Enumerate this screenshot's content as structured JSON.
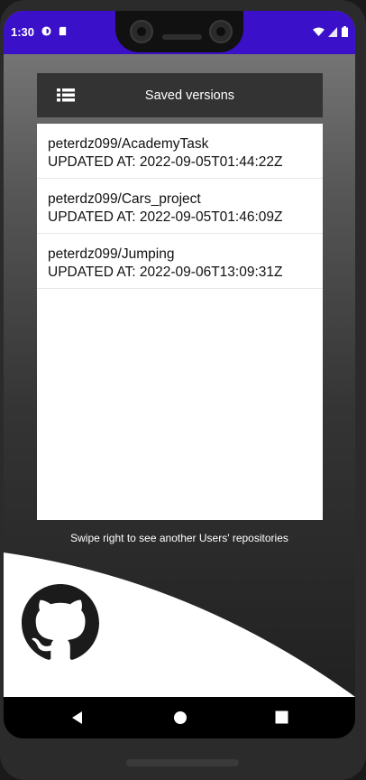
{
  "status_bar": {
    "time": "1:30"
  },
  "toolbar": {
    "title": "Saved versions",
    "menu_icon": "list-icon"
  },
  "repositories": [
    {
      "name": "peterdz099/AcademyTask",
      "updated": "UPDATED AT: 2022-09-05T01:44:22Z"
    },
    {
      "name": "peterdz099/Cars_project",
      "updated": "UPDATED AT: 2022-09-05T01:46:09Z"
    },
    {
      "name": "peterdz099/Jumping",
      "updated": "UPDATED AT: 2022-09-06T13:09:31Z"
    }
  ],
  "hint": "Swipe right to see another Users' repositories",
  "logo": "github-octocat-icon",
  "colors": {
    "status_bar": "#3a10c9",
    "toolbar": "#333333",
    "panel": "#ffffff"
  }
}
